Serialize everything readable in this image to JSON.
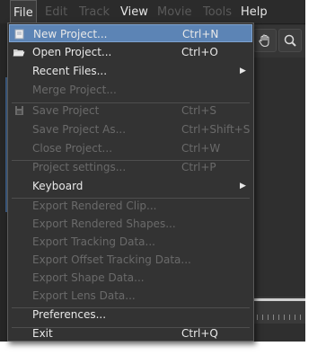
{
  "menubar": {
    "items": [
      {
        "label": "File",
        "state": "active"
      },
      {
        "label": "Edit",
        "state": "disabled"
      },
      {
        "label": "Track",
        "state": "disabled"
      },
      {
        "label": "View",
        "state": "enabled"
      },
      {
        "label": "Movie",
        "state": "disabled"
      },
      {
        "label": "Tools",
        "state": "disabled"
      },
      {
        "label": "Help",
        "state": "enabled"
      }
    ]
  },
  "toolbar": {
    "icons": [
      "hand-icon",
      "zoom-icon"
    ]
  },
  "file_menu": {
    "items": [
      {
        "label": "New Project...",
        "shortcut": "Ctrl+N",
        "enabled": true,
        "highlighted": true,
        "icon": "new-project-icon"
      },
      {
        "label": "Open Project...",
        "shortcut": "Ctrl+O",
        "enabled": true,
        "icon": "folder-open-icon"
      },
      {
        "label": "Recent Files...",
        "shortcut": "",
        "enabled": true,
        "submenu": true
      },
      {
        "label": "Merge Project...",
        "shortcut": "",
        "enabled": false
      },
      {
        "label": "Save Project",
        "shortcut": "Ctrl+S",
        "enabled": false,
        "icon": "save-icon"
      },
      {
        "label": "Save Project As...",
        "shortcut": "Ctrl+Shift+S",
        "enabled": false
      },
      {
        "label": "Close Project...",
        "shortcut": "Ctrl+W",
        "enabled": false
      },
      {
        "label": "Project settings...",
        "shortcut": "Ctrl+P",
        "enabled": false
      },
      {
        "label": "Keyboard",
        "shortcut": "",
        "enabled": true,
        "submenu": true
      },
      {
        "label": "Export Rendered Clip...",
        "shortcut": "",
        "enabled": false
      },
      {
        "label": "Export Rendered Shapes...",
        "shortcut": "",
        "enabled": false
      },
      {
        "label": "Export Tracking Data...",
        "shortcut": "",
        "enabled": false
      },
      {
        "label": "Export Offset Tracking Data...",
        "shortcut": "",
        "enabled": false
      },
      {
        "label": "Export Shape Data...",
        "shortcut": "",
        "enabled": false
      },
      {
        "label": "Export Lens Data...",
        "shortcut": "",
        "enabled": false
      },
      {
        "label": "Preferences...",
        "shortcut": "",
        "enabled": true
      },
      {
        "label": "Exit",
        "shortcut": "Ctrl+Q",
        "enabled": true
      }
    ]
  },
  "colors": {
    "highlight": "#5c84b5",
    "menu_bg": "#333333",
    "text": "#e8e8e8",
    "disabled_text": "#6a6a6a"
  }
}
